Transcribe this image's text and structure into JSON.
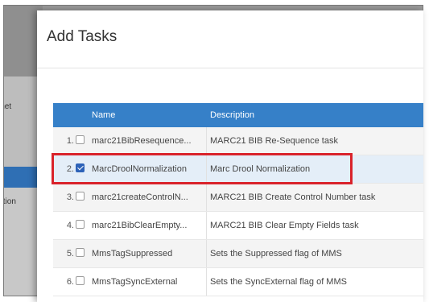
{
  "background": {
    "side_text_top": "aramet",
    "side_text_bottom": "ization"
  },
  "dialog": {
    "title": "Add Tasks"
  },
  "table": {
    "headers": {
      "name": "Name",
      "description": "Description"
    },
    "rows": [
      {
        "num": "1.",
        "checked": false,
        "name": "marc21BibResequence...",
        "description": "MARC21 BIB Re-Sequence task"
      },
      {
        "num": "2.",
        "checked": true,
        "name": "MarcDroolNormalization",
        "description": "Marc Drool Normalization"
      },
      {
        "num": "3.",
        "checked": false,
        "name": "marc21createControlN...",
        "description": "MARC21 BIB Create Control Number task"
      },
      {
        "num": "4.",
        "checked": false,
        "name": "marc21BibClearEmpty...",
        "description": "MARC21 BIB Clear Empty Fields task"
      },
      {
        "num": "5.",
        "checked": false,
        "name": "MmsTagSuppressed",
        "description": "Sets the Suppressed flag of MMS"
      },
      {
        "num": "6.",
        "checked": false,
        "name": "MmsTagSyncExternal",
        "description": "Sets the SyncExternal flag of MMS"
      }
    ]
  },
  "colors": {
    "header_blue": "#3680c8",
    "highlight_red": "#d9232b",
    "checkbox_blue": "#2c62b8"
  }
}
